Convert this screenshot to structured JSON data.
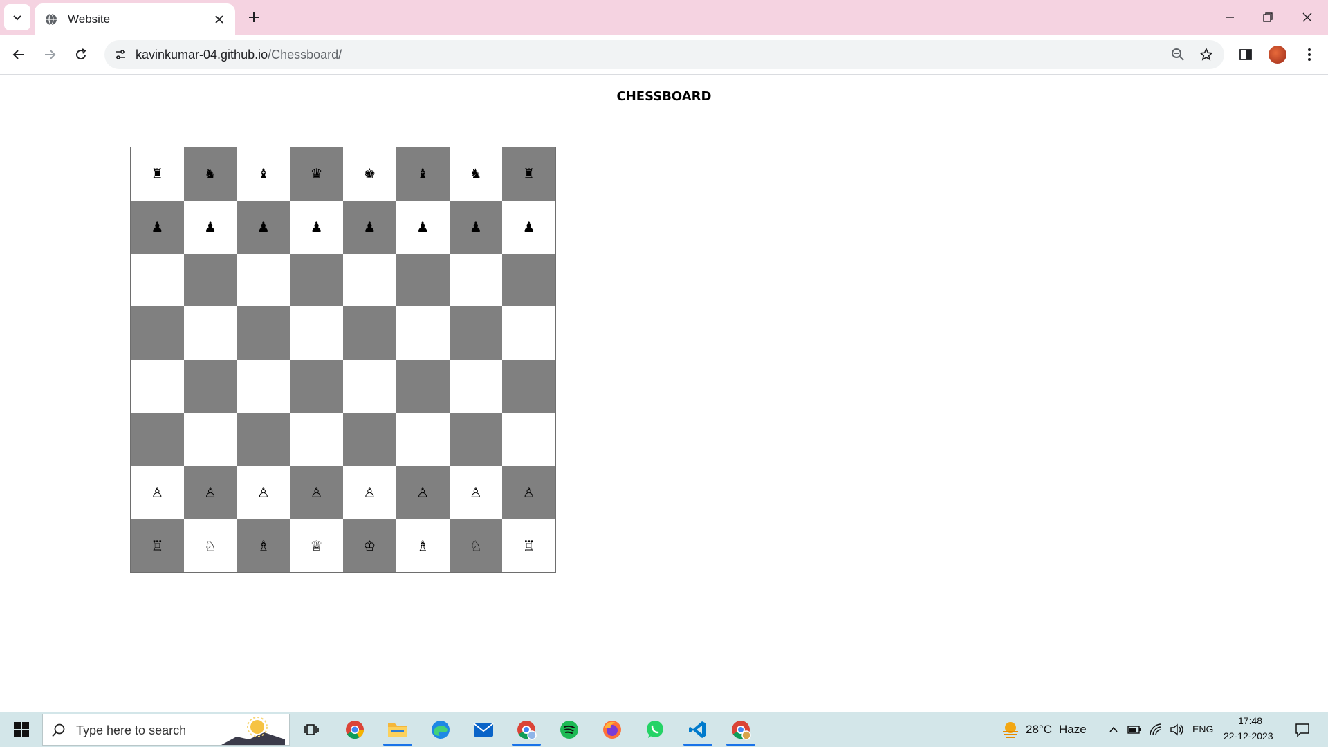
{
  "browser": {
    "tab_title": "Website",
    "url_host": "kavinkumar-04.github.io",
    "url_path": "/Chessboard/"
  },
  "page": {
    "title": "CHESSBOARD"
  },
  "board": {
    "light_color": "#ffffff",
    "dark_color": "#808080",
    "rows": [
      [
        "♜",
        "♞",
        "♝",
        "♛",
        "♚",
        "♝",
        "♞",
        "♜"
      ],
      [
        "♟",
        "♟",
        "♟",
        "♟",
        "♟",
        "♟",
        "♟",
        "♟"
      ],
      [
        "",
        "",
        "",
        "",
        "",
        "",
        "",
        ""
      ],
      [
        "",
        "",
        "",
        "",
        "",
        "",
        "",
        ""
      ],
      [
        "",
        "",
        "",
        "",
        "",
        "",
        "",
        ""
      ],
      [
        "",
        "",
        "",
        "",
        "",
        "",
        "",
        ""
      ],
      [
        "♙",
        "♙",
        "♙",
        "♙",
        "♙",
        "♙",
        "♙",
        "♙"
      ],
      [
        "♖",
        "♘",
        "♗",
        "♕",
        "♔",
        "♗",
        "♘",
        "♖"
      ]
    ]
  },
  "taskbar": {
    "search_placeholder": "Type here to search",
    "weather_temp": "28°C",
    "weather_desc": "Haze",
    "language": "ENG",
    "time": "17:48",
    "date": "22-12-2023",
    "apps": [
      "task-view",
      "chrome",
      "file-explorer",
      "edge",
      "mail",
      "chrome-profile",
      "spotify",
      "firefox",
      "whatsapp",
      "vscode",
      "chrome-active"
    ]
  },
  "colors": {
    "tabstrip": "#f5d3e1",
    "taskbar": "#d3e6e9",
    "accent": "#1a73e8"
  }
}
